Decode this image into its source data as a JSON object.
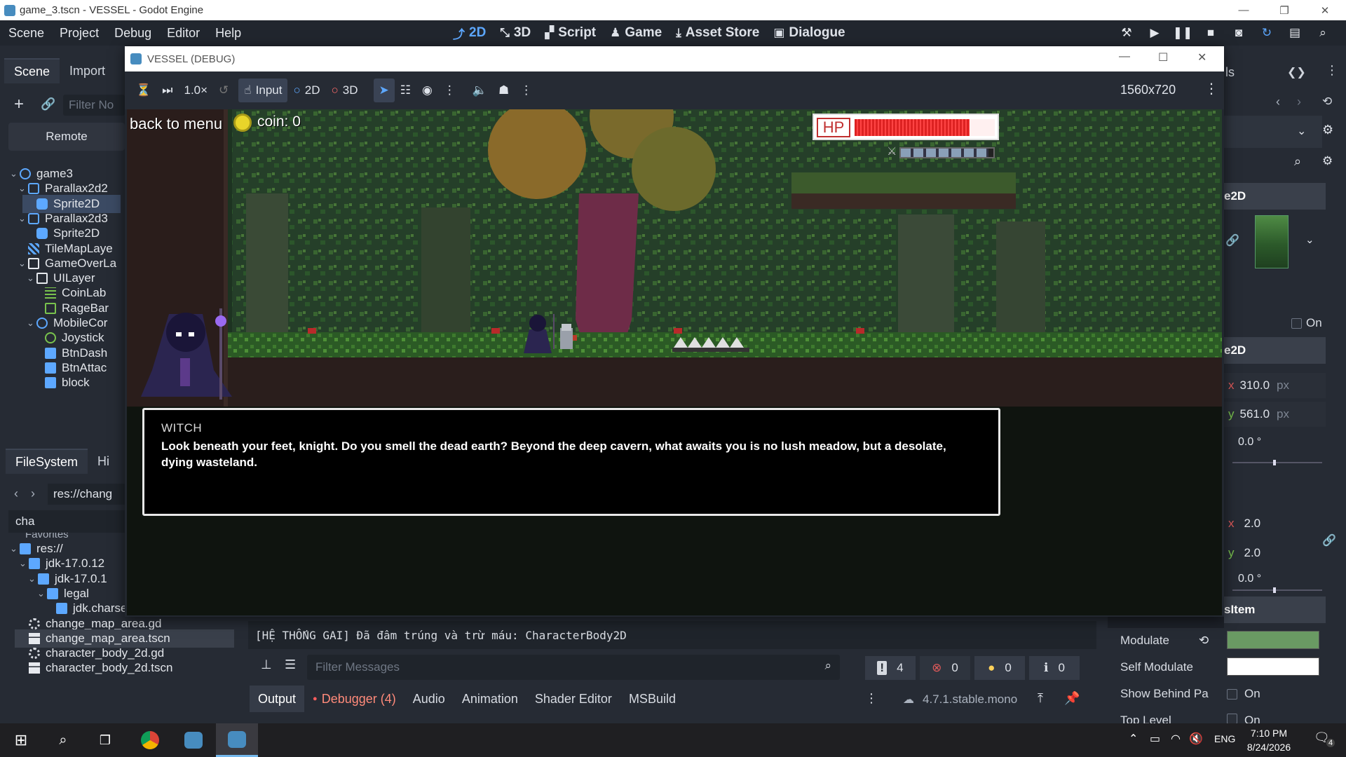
{
  "window": {
    "title": "game_3.tscn - VESSEL - Godot Engine",
    "controls": {
      "minimize": "—",
      "restore": "❐",
      "close": "✕"
    }
  },
  "menubar": {
    "items": [
      "Scene",
      "Project",
      "Debug",
      "Editor",
      "Help"
    ],
    "workspaces": [
      {
        "label": "2D",
        "icon": "2d-icon",
        "active": true
      },
      {
        "label": "3D",
        "icon": "3d-icon"
      },
      {
        "label": "Script",
        "icon": "script-icon"
      },
      {
        "label": "Game",
        "icon": "game-icon"
      },
      {
        "label": "Asset Store",
        "icon": "asset-store-icon"
      },
      {
        "label": "Dialogue",
        "icon": "dialogue-icon"
      }
    ]
  },
  "scene_dock": {
    "tabs": [
      "Scene",
      "Import"
    ],
    "filter_placeholder": "Filter No",
    "remote_button": "Remote",
    "tree": [
      {
        "label": "game3",
        "depth": 0,
        "arrow": "v",
        "icon": "node-icon"
      },
      {
        "label": "Parallax2d2",
        "depth": 1,
        "arrow": "v",
        "icon": "parallax-icon"
      },
      {
        "label": "Sprite2D",
        "depth": 2,
        "arrow": "",
        "icon": "sprite-icon",
        "selected": true
      },
      {
        "label": "Parallax2d3",
        "depth": 1,
        "arrow": "v",
        "icon": "parallax-icon"
      },
      {
        "label": "Sprite2D",
        "depth": 2,
        "arrow": "",
        "icon": "sprite-icon"
      },
      {
        "label": "TileMapLaye",
        "depth": 1,
        "arrow": "",
        "icon": "tilemap-icon"
      },
      {
        "label": "GameOverLa",
        "depth": 1,
        "arrow": "v",
        "icon": "canvas-layer-icon"
      },
      {
        "label": "UILayer",
        "depth": 2,
        "arrow": "v",
        "icon": "canvas-layer-icon"
      },
      {
        "label": "CoinLab",
        "depth": 3,
        "arrow": "",
        "icon": "label-icon"
      },
      {
        "label": "RageBar",
        "depth": 3,
        "arrow": "",
        "icon": "progress-icon"
      },
      {
        "label": "MobileCor",
        "depth": 2,
        "arrow": "v",
        "icon": "node-icon"
      },
      {
        "label": "Joystick",
        "depth": 3,
        "arrow": "",
        "icon": "node-green-icon"
      },
      {
        "label": "BtnDash",
        "depth": 3,
        "arrow": "",
        "icon": "touch-button-icon"
      },
      {
        "label": "BtnAttac",
        "depth": 3,
        "arrow": "",
        "icon": "touch-button-icon"
      },
      {
        "label": "block",
        "depth": 3,
        "arrow": "",
        "icon": "touch-button-icon"
      }
    ]
  },
  "filesystem_dock": {
    "tabs": [
      "FileSystem",
      "Hi"
    ],
    "path": "res://chang",
    "search_value": "cha",
    "favorites_label": "Favorites",
    "tree": [
      {
        "label": "res://",
        "depth": 0,
        "arrow": "v",
        "icon": "folder-icon"
      },
      {
        "label": "jdk-17.0.12",
        "depth": 1,
        "arrow": "v",
        "icon": "folder-icon"
      },
      {
        "label": "jdk-17.0.1",
        "depth": 2,
        "arrow": "v",
        "icon": "folder-icon"
      },
      {
        "label": "legal",
        "depth": 3,
        "arrow": "v",
        "icon": "folder-icon"
      },
      {
        "label": "jdk.charsets",
        "depth": 4,
        "arrow": "",
        "icon": "folder-icon"
      },
      {
        "label": "change_map_area.gd",
        "depth": 1,
        "arrow": "",
        "icon": "gear-icon"
      },
      {
        "label": "change_map_area.tscn",
        "depth": 1,
        "arrow": "",
        "icon": "clapper-icon",
        "selected": true
      },
      {
        "label": "character_body_2d.gd",
        "depth": 1,
        "arrow": "",
        "icon": "gear-icon"
      },
      {
        "label": "character_body_2d.tscn",
        "depth": 1,
        "arrow": "",
        "icon": "clapper-icon"
      }
    ]
  },
  "inspector": {
    "tab_fragment": "ls",
    "section_node2d": "e2D",
    "section_transform": "e2D",
    "section_canvas": "sItem",
    "on_label": "On",
    "position": {
      "x": "310.0",
      "y": "561.0",
      "unit": "px"
    },
    "rotation": "0.0 °",
    "scale": {
      "x": "2.0",
      "y": "2.0"
    },
    "skew": "0.0 °",
    "visible_label": "On",
    "modulate_label": "Modulate",
    "self_modulate_label": "Self Modulate",
    "show_behind_label": "Show Behind Pa",
    "show_behind_value": "On",
    "top_level_label": "Top Level",
    "top_level_value": "On",
    "modulate_color": "#6a9a63",
    "self_modulate_color": "#ffffff"
  },
  "bottom_panel": {
    "output_line": "[HỆ THỐNG GAI] Đã đâm trúng và trừ máu: CharacterBody2D",
    "filter_placeholder": "Filter Messages",
    "counts": {
      "messages": "4",
      "errors": "0",
      "warnings": "0",
      "info": "0"
    },
    "tabs": [
      "Output",
      "Debugger (4)",
      "Audio",
      "Animation",
      "Shader Editor",
      "MSBuild"
    ],
    "version": "4.7.1.stable.mono"
  },
  "debug_window": {
    "title": "VESSEL (DEBUG)",
    "speed": "1.0×",
    "input_label": "Input",
    "btn_2d": "2D",
    "btn_3d": "3D",
    "resolution": "1560x720"
  },
  "game": {
    "back_to_menu": "back to menu",
    "coin_text": "coin: 0",
    "hp_label": "HP",
    "dialogue_speaker": "WITCH",
    "dialogue_text": "Look beneath your feet, knight. Do you smell the dead earth? Beyond the deep cavern, what awaits you is no lush meadow, but a desolate, dying wasteland.",
    "hp_fraction": 0.82,
    "rage_fraction": 0.95
  },
  "taskbar": {
    "apps": [
      "windows-start-icon",
      "search-icon",
      "task-view-icon",
      "chrome-icon",
      "godot-icon",
      "godot-icon"
    ],
    "lang": "ENG",
    "time": "7:10 PM",
    "date": "8/24/2026",
    "notif_count": "4"
  }
}
